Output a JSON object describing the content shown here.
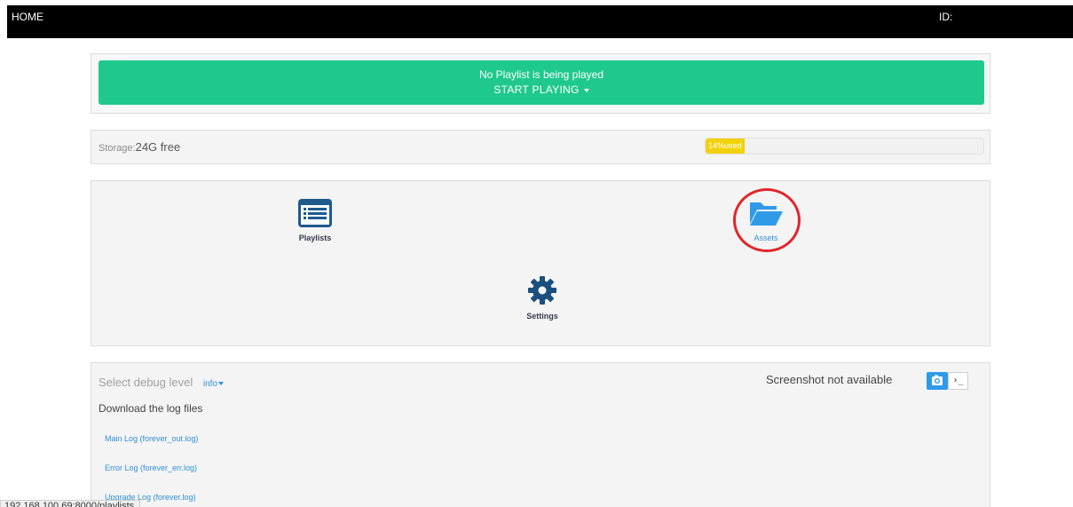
{
  "topbar": {
    "home_label": "HOME",
    "id_label": "ID:"
  },
  "player": {
    "status_text": "No Playlist is being played",
    "start_label": "START PLAYING"
  },
  "storage": {
    "label": "Storage:",
    "free_text": "24G free",
    "used_percent": 14,
    "used_label": "14%used"
  },
  "nav": {
    "playlists_label": "Playlists",
    "assets_label": "Assets",
    "settings_label": "Settings"
  },
  "debug": {
    "select_label": "Select debug level",
    "level_value": "info",
    "download_label": "Download the log files",
    "logs": [
      {
        "label": "Main Log (forever_out.log)"
      },
      {
        "label": "Error Log (forever_err.log)"
      },
      {
        "label": "Upgrade Log (forever.log)"
      }
    ],
    "screenshot_label": "Screenshot not available",
    "terminal_glyph": "›_"
  },
  "statusbar": {
    "url": "192.168.100.69:8000/playlists"
  },
  "colors": {
    "topbar": "#000000",
    "play_button": "#1fc98e",
    "progress_fill": "#f2d20a",
    "link": "#2f8fd8",
    "playlists_icon": "#1e5a8e",
    "assets_icon": "#2f9be8",
    "highlight_circle": "#e0262b"
  },
  "icons": {
    "playlists": "list-icon",
    "assets": "folder-open-icon",
    "settings": "gear-icon",
    "screenshot": "camera-icon",
    "terminal": "terminal-icon"
  }
}
